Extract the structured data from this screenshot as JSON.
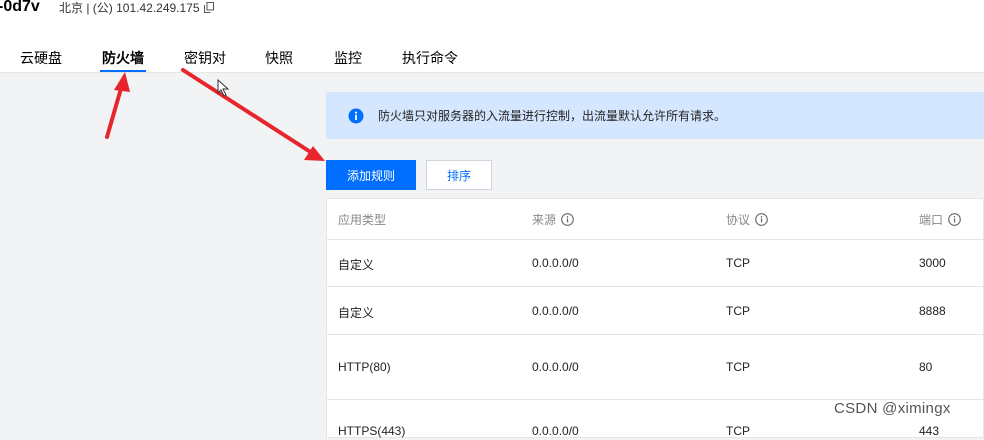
{
  "header": {
    "instance_name": "-0d7v",
    "meta": "北京 | (公) 101.42.249.175"
  },
  "tabs": [
    {
      "label": "云硬盘",
      "active": false
    },
    {
      "label": "防火墙",
      "active": true
    },
    {
      "label": "密钥对",
      "active": false
    },
    {
      "label": "快照",
      "active": false
    },
    {
      "label": "监控",
      "active": false
    },
    {
      "label": "执行命令",
      "active": false
    }
  ],
  "notice": {
    "icon": "info-icon",
    "text": "防火墙只对服务器的入流量进行控制，出流量默认允许所有请求。"
  },
  "toolbar": {
    "add_rule_label": "添加规则",
    "sort_label": "排序"
  },
  "table": {
    "columns": [
      "应用类型",
      "来源",
      "协议",
      "端口"
    ],
    "rows": [
      {
        "type": "自定义",
        "source": "0.0.0.0/0",
        "protocol": "TCP",
        "port": "3000"
      },
      {
        "type": "自定义",
        "source": "0.0.0.0/0",
        "protocol": "TCP",
        "port": "8888"
      },
      {
        "type": "HTTP(80)",
        "source": "0.0.0.0/0",
        "protocol": "TCP",
        "port": "80"
      },
      {
        "type": "HTTPS(443)",
        "source": "0.0.0.0/0",
        "protocol": "TCP",
        "port": "443"
      }
    ]
  },
  "watermark": "CSDN @ximingx",
  "colors": {
    "accent": "#006eff",
    "notice_bg": "#d5e7ff",
    "annotation_arrow": "#e8252c"
  }
}
